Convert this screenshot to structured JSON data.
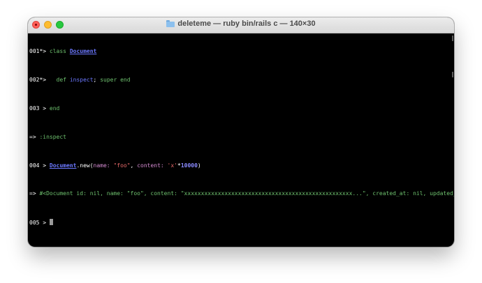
{
  "window": {
    "title": "deleteme — ruby bin/rails c — 140×30",
    "folder_icon": "folder-icon"
  },
  "terminal": {
    "line1": {
      "prompt": "001*> ",
      "kw": "class",
      "sp": " ",
      "name": "Document"
    },
    "line2": {
      "prompt": "002*> ",
      "indent": "  ",
      "kw": "def",
      "sp": " ",
      "meth": "inspect",
      "semi": "; ",
      "rest": "super end"
    },
    "line3": {
      "prompt": "003 > ",
      "kw": "end"
    },
    "line4": {
      "arrow": "=> ",
      "value": ":inspect"
    },
    "line5": {
      "prompt": "004 > ",
      "const": "Document",
      "dot_new": ".new(",
      "name_key": "name:",
      "sp1": " ",
      "name_val": "\"foo\"",
      "comma": ", ",
      "content_key": "content:",
      "sp2": " ",
      "content_val": "'x'",
      "star": "*",
      "num": "10000",
      "close": ")"
    },
    "line6": {
      "arrow": "=> ",
      "value": "#<Document id: nil, name: \"foo\", content: \"xxxxxxxxxxxxxxxxxxxxxxxxxxxxxxxxxxxxxxxxxxxxxxxxxx...\", created_at: nil, updated_at: nil>"
    },
    "line7": {
      "prompt": "005 > "
    }
  },
  "colors": {
    "background": "#000000",
    "keyword": "#6ec16e",
    "constant": "#6b78ff",
    "string": "#e86a6a",
    "number": "#8a8aff"
  }
}
